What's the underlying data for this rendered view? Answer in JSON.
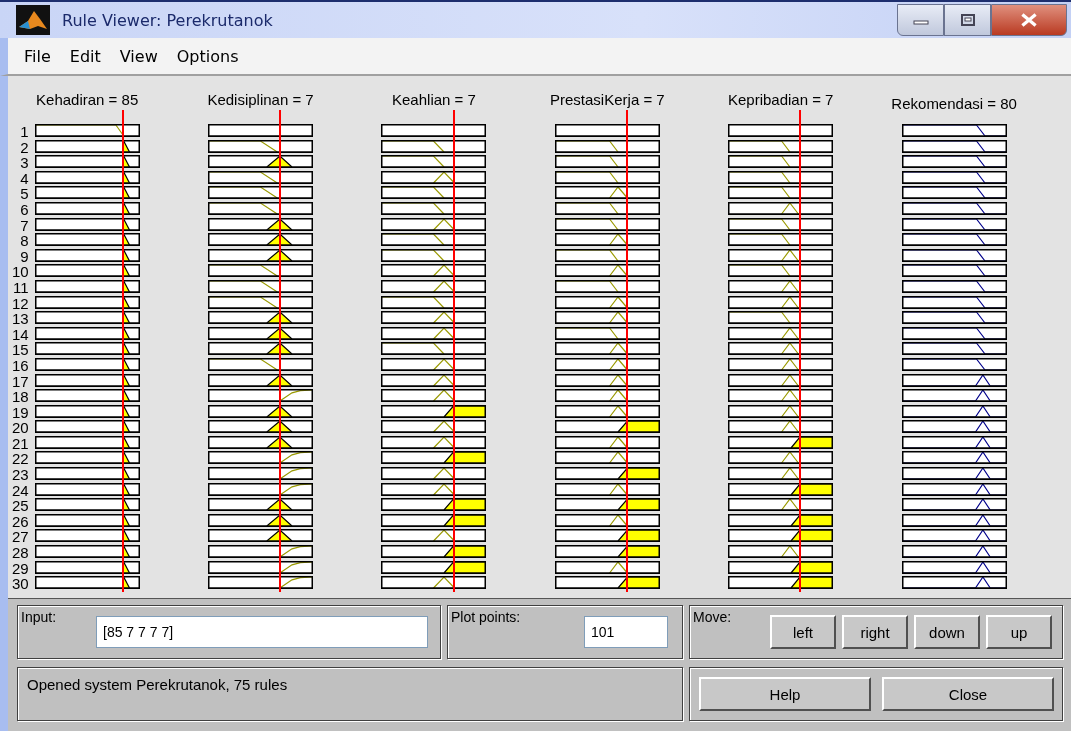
{
  "window": {
    "title": "Rule Viewer: Perekrutanok"
  },
  "menu": [
    "File",
    "Edit",
    "View",
    "Options"
  ],
  "variables": [
    {
      "label": "Kehadiran = 85",
      "kind": "input"
    },
    {
      "label": "Kedisiplinan = 7",
      "kind": "input"
    },
    {
      "label": "Keahlian = 7",
      "kind": "input"
    },
    {
      "label": "PrestasiKerja = 7",
      "kind": "input"
    },
    {
      "label": "Kepribadian = 7",
      "kind": "input"
    },
    {
      "label": "Rekomendasi = 80",
      "kind": "output"
    }
  ],
  "rules": [
    {
      "number": "1",
      "cells": [
        {
          "kind": "low",
          "fired": false
        },
        {
          "kind": "none"
        },
        {
          "kind": "none"
        },
        {
          "kind": "none"
        },
        {
          "kind": "none"
        },
        {
          "kind": "low",
          "fired": false
        }
      ]
    },
    {
      "number": "2",
      "cells": [
        {
          "kind": "mid",
          "fired": true
        },
        {
          "kind": "low",
          "fired": false
        },
        {
          "kind": "low",
          "fired": false
        },
        {
          "kind": "low",
          "fired": false
        },
        {
          "kind": "low",
          "fired": false
        },
        {
          "kind": "low",
          "fired": false
        }
      ]
    },
    {
      "number": "3",
      "cells": [
        {
          "kind": "mid",
          "fired": true
        },
        {
          "kind": "mid",
          "fired": true
        },
        {
          "kind": "low",
          "fired": false
        },
        {
          "kind": "low",
          "fired": false
        },
        {
          "kind": "low",
          "fired": false
        },
        {
          "kind": "low",
          "fired": false
        }
      ]
    },
    {
      "number": "4",
      "cells": [
        {
          "kind": "mid",
          "fired": true
        },
        {
          "kind": "low",
          "fired": false
        },
        {
          "kind": "mid",
          "fired": false
        },
        {
          "kind": "low",
          "fired": false
        },
        {
          "kind": "low",
          "fired": false
        },
        {
          "kind": "low",
          "fired": false
        }
      ]
    },
    {
      "number": "5",
      "cells": [
        {
          "kind": "mid",
          "fired": true
        },
        {
          "kind": "low",
          "fired": false
        },
        {
          "kind": "low",
          "fired": false
        },
        {
          "kind": "mid",
          "fired": false
        },
        {
          "kind": "low",
          "fired": false
        },
        {
          "kind": "low",
          "fired": false
        }
      ]
    },
    {
      "number": "6",
      "cells": [
        {
          "kind": "mid",
          "fired": true
        },
        {
          "kind": "low",
          "fired": false
        },
        {
          "kind": "low",
          "fired": false
        },
        {
          "kind": "low",
          "fired": false
        },
        {
          "kind": "mid",
          "fired": false
        },
        {
          "kind": "low",
          "fired": false
        }
      ]
    },
    {
      "number": "7",
      "cells": [
        {
          "kind": "mid",
          "fired": true
        },
        {
          "kind": "mid",
          "fired": true
        },
        {
          "kind": "mid",
          "fired": false
        },
        {
          "kind": "low",
          "fired": false
        },
        {
          "kind": "low",
          "fired": false
        },
        {
          "kind": "low",
          "fired": false
        }
      ]
    },
    {
      "number": "8",
      "cells": [
        {
          "kind": "mid",
          "fired": true
        },
        {
          "kind": "mid",
          "fired": true
        },
        {
          "kind": "low",
          "fired": false
        },
        {
          "kind": "mid",
          "fired": false
        },
        {
          "kind": "low",
          "fired": false
        },
        {
          "kind": "low",
          "fired": false
        }
      ]
    },
    {
      "number": "9",
      "cells": [
        {
          "kind": "mid",
          "fired": true
        },
        {
          "kind": "mid",
          "fired": true
        },
        {
          "kind": "low",
          "fired": false
        },
        {
          "kind": "low",
          "fired": false
        },
        {
          "kind": "mid",
          "fired": false
        },
        {
          "kind": "low",
          "fired": false
        }
      ]
    },
    {
      "number": "10",
      "cells": [
        {
          "kind": "mid",
          "fired": true
        },
        {
          "kind": "low",
          "fired": false
        },
        {
          "kind": "mid",
          "fired": false
        },
        {
          "kind": "mid",
          "fired": false
        },
        {
          "kind": "low",
          "fired": false
        },
        {
          "kind": "low",
          "fired": false
        }
      ]
    },
    {
      "number": "11",
      "cells": [
        {
          "kind": "mid",
          "fired": true
        },
        {
          "kind": "low",
          "fired": false
        },
        {
          "kind": "mid",
          "fired": false
        },
        {
          "kind": "low",
          "fired": false
        },
        {
          "kind": "mid",
          "fired": false
        },
        {
          "kind": "low",
          "fired": false
        }
      ]
    },
    {
      "number": "12",
      "cells": [
        {
          "kind": "mid",
          "fired": true
        },
        {
          "kind": "low",
          "fired": false
        },
        {
          "kind": "low",
          "fired": false
        },
        {
          "kind": "mid",
          "fired": false
        },
        {
          "kind": "mid",
          "fired": false
        },
        {
          "kind": "low",
          "fired": false
        }
      ]
    },
    {
      "number": "13",
      "cells": [
        {
          "kind": "mid",
          "fired": true
        },
        {
          "kind": "mid",
          "fired": true
        },
        {
          "kind": "mid",
          "fired": false
        },
        {
          "kind": "mid",
          "fired": false
        },
        {
          "kind": "low",
          "fired": false
        },
        {
          "kind": "low",
          "fired": false
        }
      ]
    },
    {
      "number": "14",
      "cells": [
        {
          "kind": "mid",
          "fired": true
        },
        {
          "kind": "mid",
          "fired": true
        },
        {
          "kind": "mid",
          "fired": false
        },
        {
          "kind": "low",
          "fired": false
        },
        {
          "kind": "mid",
          "fired": false
        },
        {
          "kind": "low",
          "fired": false
        }
      ]
    },
    {
      "number": "15",
      "cells": [
        {
          "kind": "mid",
          "fired": true
        },
        {
          "kind": "mid",
          "fired": true
        },
        {
          "kind": "low",
          "fired": false
        },
        {
          "kind": "mid",
          "fired": false
        },
        {
          "kind": "mid",
          "fired": false
        },
        {
          "kind": "low",
          "fired": false
        }
      ]
    },
    {
      "number": "16",
      "cells": [
        {
          "kind": "mid",
          "fired": true
        },
        {
          "kind": "low",
          "fired": false
        },
        {
          "kind": "mid",
          "fired": false
        },
        {
          "kind": "mid",
          "fired": false
        },
        {
          "kind": "mid",
          "fired": false
        },
        {
          "kind": "low",
          "fired": false
        }
      ]
    },
    {
      "number": "17",
      "cells": [
        {
          "kind": "mid",
          "fired": true
        },
        {
          "kind": "mid",
          "fired": true
        },
        {
          "kind": "mid",
          "fired": false
        },
        {
          "kind": "mid",
          "fired": false
        },
        {
          "kind": "mid",
          "fired": false
        },
        {
          "kind": "mid",
          "fired": false
        }
      ]
    },
    {
      "number": "18",
      "cells": [
        {
          "kind": "mid",
          "fired": true
        },
        {
          "kind": "high",
          "fired": false
        },
        {
          "kind": "mid",
          "fired": false
        },
        {
          "kind": "mid",
          "fired": false
        },
        {
          "kind": "mid",
          "fired": false
        },
        {
          "kind": "mid",
          "fired": false
        }
      ]
    },
    {
      "number": "19",
      "cells": [
        {
          "kind": "mid",
          "fired": true
        },
        {
          "kind": "mid",
          "fired": true
        },
        {
          "kind": "high",
          "fired": true
        },
        {
          "kind": "mid",
          "fired": false
        },
        {
          "kind": "mid",
          "fired": false
        },
        {
          "kind": "mid",
          "fired": false
        }
      ]
    },
    {
      "number": "20",
      "cells": [
        {
          "kind": "mid",
          "fired": true
        },
        {
          "kind": "mid",
          "fired": true
        },
        {
          "kind": "mid",
          "fired": false
        },
        {
          "kind": "high",
          "fired": true
        },
        {
          "kind": "mid",
          "fired": false
        },
        {
          "kind": "mid",
          "fired": false
        }
      ]
    },
    {
      "number": "21",
      "cells": [
        {
          "kind": "mid",
          "fired": true
        },
        {
          "kind": "mid",
          "fired": true
        },
        {
          "kind": "mid",
          "fired": false
        },
        {
          "kind": "mid",
          "fired": false
        },
        {
          "kind": "high",
          "fired": true
        },
        {
          "kind": "mid",
          "fired": false
        }
      ]
    },
    {
      "number": "22",
      "cells": [
        {
          "kind": "mid",
          "fired": true
        },
        {
          "kind": "high",
          "fired": false
        },
        {
          "kind": "high",
          "fired": true
        },
        {
          "kind": "mid",
          "fired": false
        },
        {
          "kind": "mid",
          "fired": false
        },
        {
          "kind": "mid",
          "fired": false
        }
      ]
    },
    {
      "number": "23",
      "cells": [
        {
          "kind": "mid",
          "fired": true
        },
        {
          "kind": "high",
          "fired": false
        },
        {
          "kind": "mid",
          "fired": false
        },
        {
          "kind": "high",
          "fired": true
        },
        {
          "kind": "mid",
          "fired": false
        },
        {
          "kind": "mid",
          "fired": false
        }
      ]
    },
    {
      "number": "24",
      "cells": [
        {
          "kind": "mid",
          "fired": true
        },
        {
          "kind": "high",
          "fired": false
        },
        {
          "kind": "mid",
          "fired": false
        },
        {
          "kind": "mid",
          "fired": false
        },
        {
          "kind": "high",
          "fired": true
        },
        {
          "kind": "mid",
          "fired": false
        }
      ]
    },
    {
      "number": "25",
      "cells": [
        {
          "kind": "mid",
          "fired": true
        },
        {
          "kind": "mid",
          "fired": true
        },
        {
          "kind": "high",
          "fired": true
        },
        {
          "kind": "high",
          "fired": true
        },
        {
          "kind": "mid",
          "fired": false
        },
        {
          "kind": "mid",
          "fired": false
        }
      ]
    },
    {
      "number": "26",
      "cells": [
        {
          "kind": "mid",
          "fired": true
        },
        {
          "kind": "mid",
          "fired": true
        },
        {
          "kind": "high",
          "fired": true
        },
        {
          "kind": "mid",
          "fired": false
        },
        {
          "kind": "high",
          "fired": true
        },
        {
          "kind": "mid",
          "fired": false
        }
      ]
    },
    {
      "number": "27",
      "cells": [
        {
          "kind": "mid",
          "fired": true
        },
        {
          "kind": "mid",
          "fired": true
        },
        {
          "kind": "mid",
          "fired": false
        },
        {
          "kind": "high",
          "fired": true
        },
        {
          "kind": "high",
          "fired": true
        },
        {
          "kind": "mid",
          "fired": false
        }
      ]
    },
    {
      "number": "28",
      "cells": [
        {
          "kind": "mid",
          "fired": true
        },
        {
          "kind": "high",
          "fired": false
        },
        {
          "kind": "high",
          "fired": true
        },
        {
          "kind": "high",
          "fired": true
        },
        {
          "kind": "mid",
          "fired": false
        },
        {
          "kind": "mid",
          "fired": false
        }
      ]
    },
    {
      "number": "29",
      "cells": [
        {
          "kind": "mid",
          "fired": true
        },
        {
          "kind": "high",
          "fired": false
        },
        {
          "kind": "high",
          "fired": true
        },
        {
          "kind": "mid",
          "fired": false
        },
        {
          "kind": "high",
          "fired": true
        },
        {
          "kind": "mid",
          "fired": false
        }
      ]
    },
    {
      "number": "30",
      "cells": [
        {
          "kind": "mid",
          "fired": true
        },
        {
          "kind": "high",
          "fired": false
        },
        {
          "kind": "mid",
          "fired": false
        },
        {
          "kind": "high",
          "fired": true
        },
        {
          "kind": "high",
          "fired": true
        },
        {
          "kind": "mid",
          "fired": false
        }
      ]
    }
  ],
  "controls": {
    "input_label": "Input:",
    "input_value": "[85 7 7 7 7]",
    "points_label": "Plot points:",
    "points_value": "101",
    "move_label": "Move:",
    "move_buttons": [
      "left",
      "right",
      "down",
      "up"
    ],
    "status": "Opened system Perekrutanok, 75 rules",
    "buttons": [
      "Help",
      "Close"
    ]
  }
}
